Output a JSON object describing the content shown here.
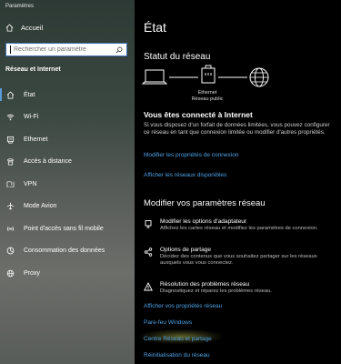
{
  "window": {
    "title": "Paramètres"
  },
  "sidebar": {
    "home_label": "Accueil",
    "search_placeholder": "Rechercher un paramètre",
    "section_title": "Réseau et Internet",
    "items": [
      {
        "label": "État",
        "icon": "home-icon",
        "active": true
      },
      {
        "label": "Wi-Fi",
        "icon": "wifi-icon"
      },
      {
        "label": "Ethernet",
        "icon": "ethernet-icon"
      },
      {
        "label": "Accès à distance",
        "icon": "dialup-icon"
      },
      {
        "label": "VPN",
        "icon": "vpn-icon"
      },
      {
        "label": "Mode Avion",
        "icon": "airplane-icon"
      },
      {
        "label": "Point d'accès sans fil mobile",
        "icon": "hotspot-icon"
      },
      {
        "label": "Consommation des données",
        "icon": "data-usage-icon"
      },
      {
        "label": "Proxy",
        "icon": "globe-icon"
      }
    ]
  },
  "main": {
    "title": "État",
    "network_status_title": "Statut du réseau",
    "diagram": {
      "adapter_label": "Ethernet",
      "network_label": "Réseau public"
    },
    "connected_title": "Vous êtes connecté à Internet",
    "connected_desc": "Si vous disposez d'un forfait de données limitées, vous pouvez configurer ce réseau en tant que connexion limitée ou modifier d'autres propriétés.",
    "link_properties": "Modifier les propriétés de connexion",
    "link_networks": "Afficher les réseaux disponibles",
    "modify_title": "Modifier vos paramètres réseau",
    "options": [
      {
        "title": "Modifier les options d'adaptateur",
        "desc": "Affichez les cartes réseau et modifiez les paramètres de connexion.",
        "icon": "adapter-icon"
      },
      {
        "title": "Options de partage",
        "desc": "Décidez des contenus que vous souhaitez partager sur les réseaux auxquels vous vous connectez.",
        "icon": "sharing-icon"
      },
      {
        "title": "Résolution des problèmes réseau",
        "desc": "Diagnostiquez et réparez les problèmes réseau.",
        "icon": "warning-icon"
      }
    ],
    "link_hardware": "Afficher vos propriétés réseau",
    "link_firewall": "Pare-feu Windows",
    "link_center": "Centre Réseau et partage",
    "link_reset": "Réinitialisation du réseau"
  },
  "colors": {
    "accent": "#4ea1e6",
    "active_indicator": "#5a9bd8",
    "main_bg": "#000000"
  }
}
